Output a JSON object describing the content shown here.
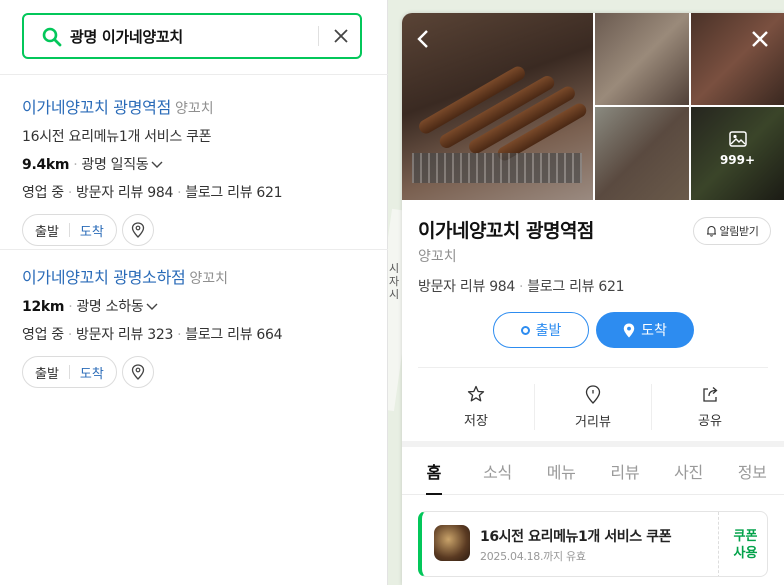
{
  "search": {
    "query": "광명 이가네양꼬치"
  },
  "results": [
    {
      "name": "이가네양꼬치 광명역점",
      "category": "양꼬치",
      "coupon": "16시전 요리메뉴1개 서비스 쿠폰",
      "distance": "9.4km",
      "area": "광명 일직동",
      "status": "영업 중",
      "visitor_review": "방문자 리뷰 984",
      "blog_review": "블로그 리뷰 621",
      "depart": "출발",
      "arrive": "도착"
    },
    {
      "name": "이가네양꼬치 광명소하점",
      "category": "양꼬치",
      "distance": "12km",
      "area": "광명 소하동",
      "status": "영업 중",
      "visitor_review": "방문자 리뷰 323",
      "blog_review": "블로그 리뷰 664",
      "depart": "출발",
      "arrive": "도착"
    }
  ],
  "map": {
    "label": "시자시"
  },
  "place": {
    "photo_count": "999+",
    "name": "이가네양꼬치 광명역점",
    "alarm": "알림받기",
    "category": "양꼬치",
    "visitor_review": "방문자 리뷰 984",
    "blog_review": "블로그 리뷰 621",
    "depart": "출발",
    "arrive": "도착",
    "actions": {
      "save": "저장",
      "street_view": "거리뷰",
      "share": "공유"
    },
    "tabs": [
      "홈",
      "소식",
      "메뉴",
      "리뷰",
      "사진",
      "정보"
    ],
    "coupon": {
      "title": "16시전 요리메뉴1개 서비스 쿠폰",
      "valid": "2025.04.18.까지 유효",
      "use_line1": "쿠폰",
      "use_line2": "사용"
    }
  },
  "colors": {
    "green": "#03c75a",
    "blue": "#2d8cf0",
    "link": "#2a6bb8"
  }
}
